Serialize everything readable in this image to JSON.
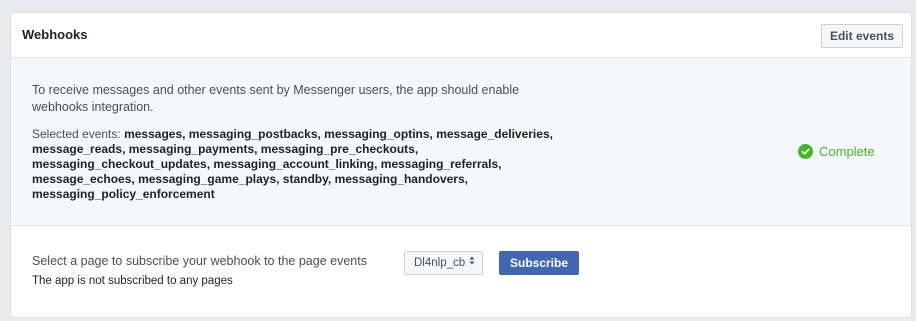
{
  "header": {
    "title": "Webhooks",
    "edit_button_label": "Edit events"
  },
  "webhooks_info": {
    "intro": "To receive messages and other events sent by Messenger users, the app should enable webhooks integration.",
    "selected_events_prefix": "Selected events:",
    "selected_events": "messages, messaging_postbacks, messaging_optins, message_deliveries, message_reads, messaging_payments, messaging_pre_checkouts, messaging_checkout_updates, messaging_account_linking, messaging_referrals, message_echoes, messaging_game_plays, standby, messaging_handovers, messaging_policy_enforcement",
    "status_label": "Complete",
    "status_icon": "check-circle-icon",
    "status_color": "#42b72a"
  },
  "subscribe": {
    "prompt": "Select a page to subscribe your webhook to the page events",
    "page_select_value": "Dl4nlp_cb",
    "page_select_icon": "up-down-caret-icon",
    "button_label": "Subscribe",
    "button_color": "#4267b2",
    "note": "The app is not subscribed to any pages"
  }
}
